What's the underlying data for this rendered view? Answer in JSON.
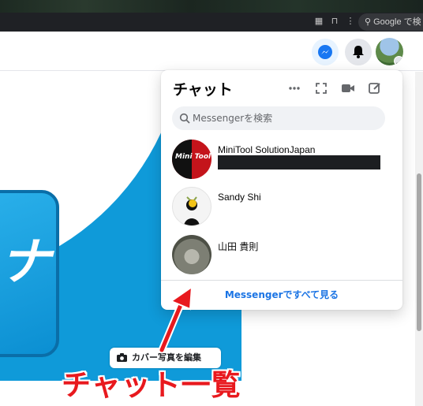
{
  "browser": {
    "search_placeholder": "Google で検"
  },
  "header": {
    "messenger_icon": "messenger-icon",
    "notifications_icon": "bell-icon",
    "account_icon": "account-avatar"
  },
  "chat_panel": {
    "title": "チャット",
    "actions": [
      "more-options-icon",
      "expand-icon",
      "video-call-icon",
      "new-message-icon"
    ],
    "search_placeholder": "Messengerを検索",
    "conversations": [
      {
        "name": "MiniTool SolutionJapan",
        "avatar_text": "Mini Tool",
        "preview_redacted": true
      },
      {
        "name": "Sandy Shi"
      },
      {
        "name": "山田 貴則"
      }
    ],
    "see_all": "Messengerですべて見る"
  },
  "cover": {
    "edit_button": "カバー写真を編集",
    "app_letter": "ナ"
  },
  "annotation": {
    "label": "チャット一覧",
    "color": "#e8191e"
  },
  "colors": {
    "accent": "#1b74e4",
    "cover_blue": "#0f9ad9"
  }
}
